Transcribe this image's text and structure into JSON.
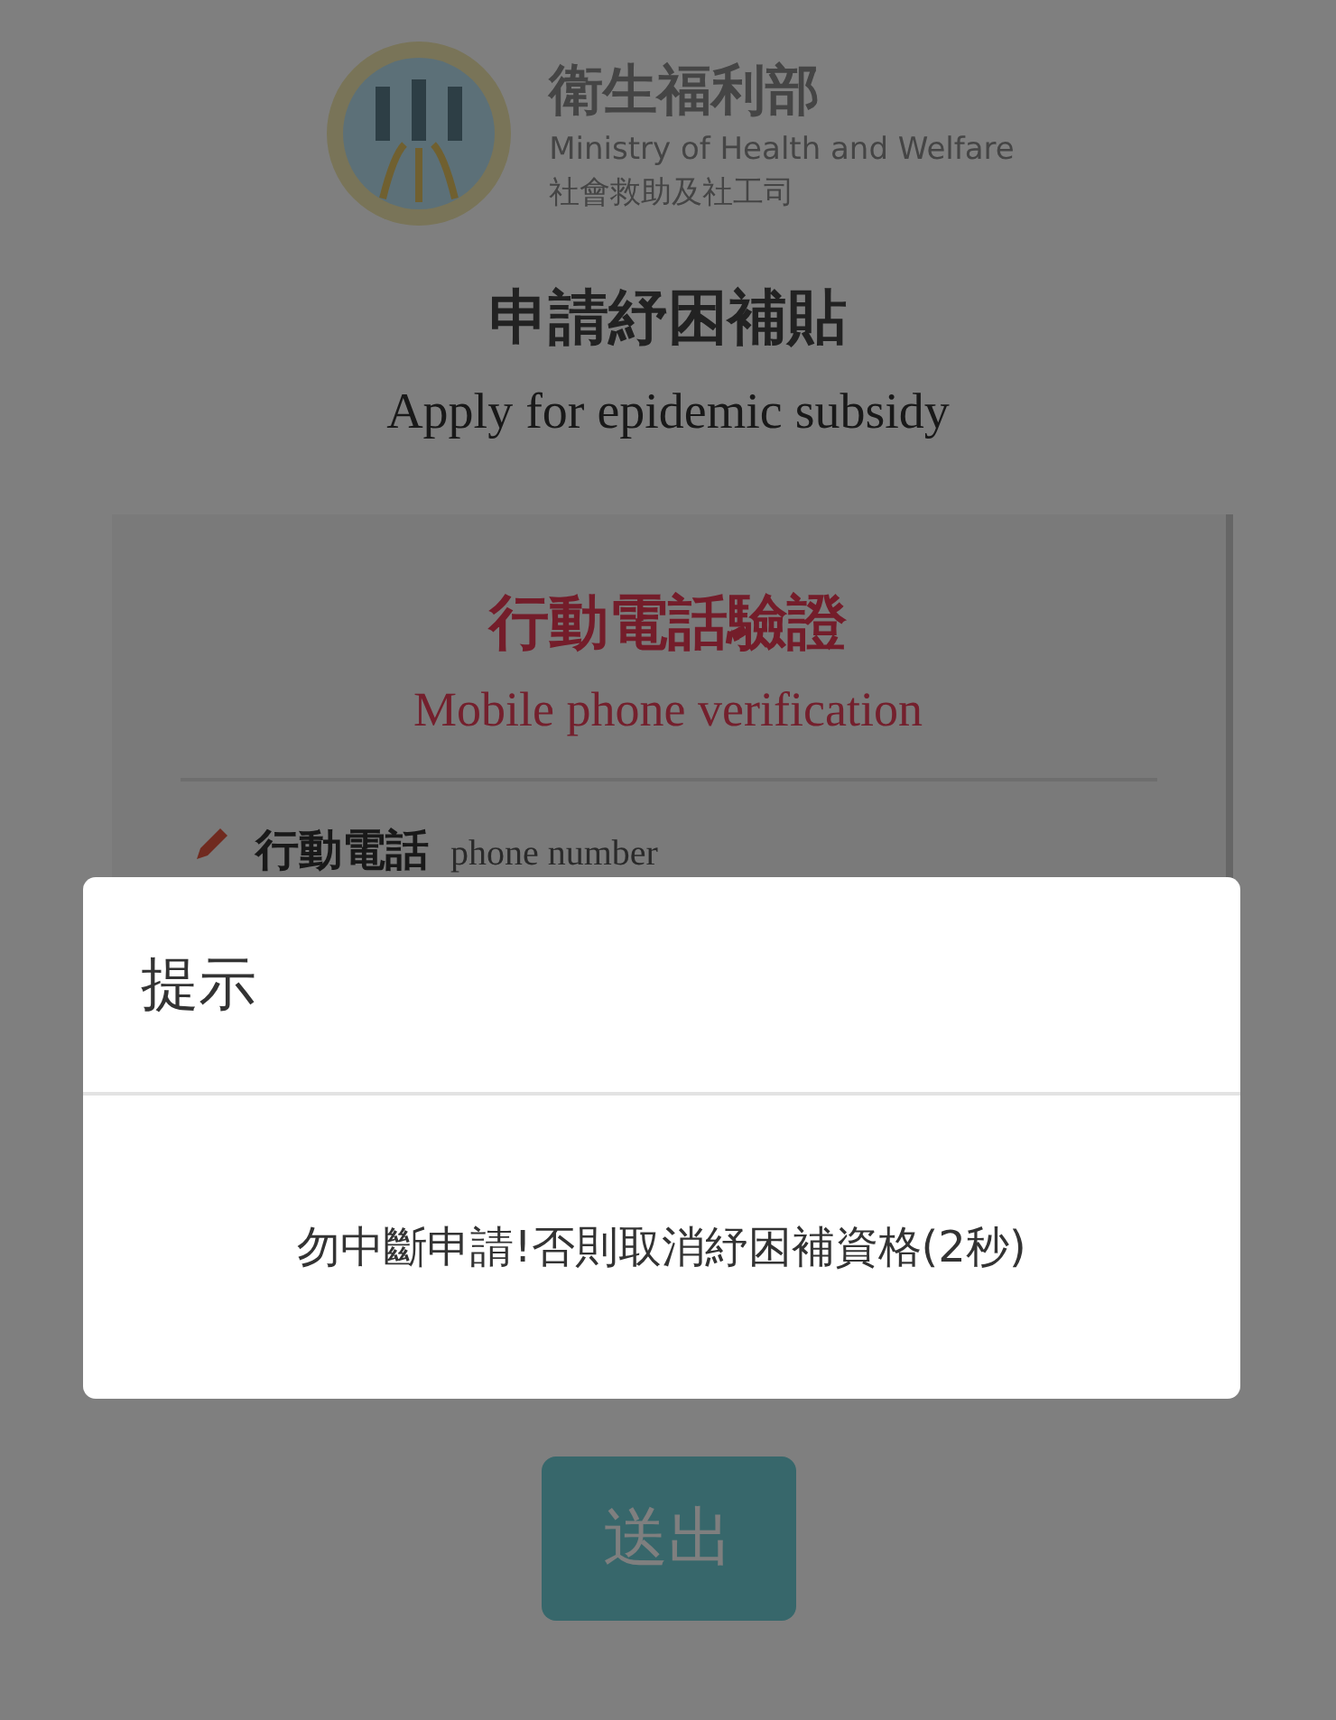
{
  "logo": {
    "lines": [
      "衛生福利部",
      "Ministry of Health and Welfare",
      "社會救助及社工司"
    ]
  },
  "header": {
    "title": "申請紓困補貼",
    "subtitle": "Apply for epidemic subsidy"
  },
  "card": {
    "title": "行動電話驗證",
    "subtitle": "Mobile phone verification",
    "field": {
      "label": "行動電話",
      "hint": "phone number"
    }
  },
  "submit_button": {
    "label": "送出"
  },
  "dialog": {
    "title": "提示",
    "message": "勿中斷申請!否則取消紓困補資格(2秒)"
  }
}
